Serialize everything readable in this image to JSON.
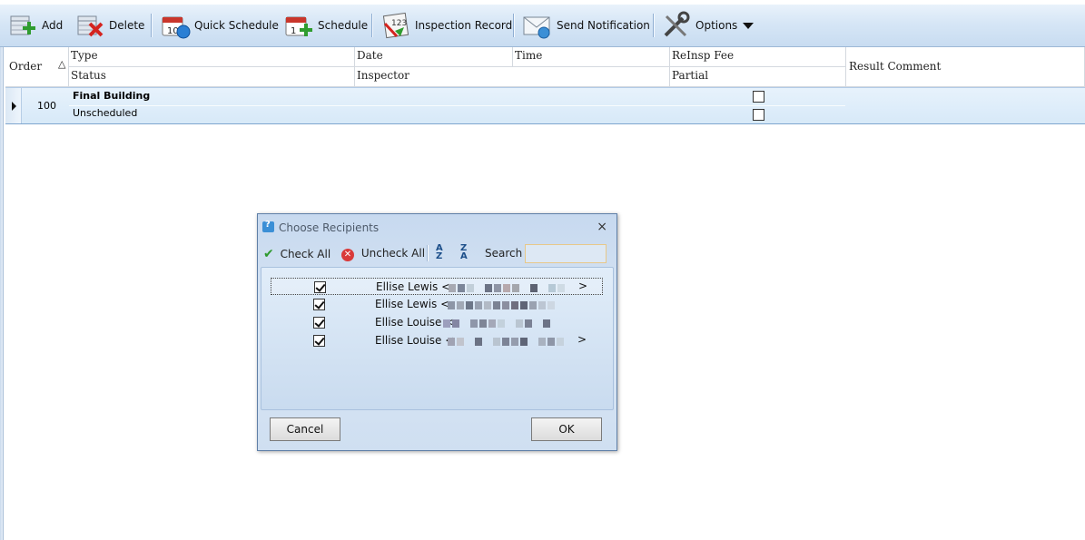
{
  "toolbar": {
    "add": "Add",
    "delete": "Delete",
    "quick_schedule": "Quick Schedule",
    "schedule": "Schedule",
    "inspection_record": "Inspection Record",
    "send_notification": "Send Notification",
    "options": "Options"
  },
  "grid": {
    "headers": {
      "order": "Order",
      "type": "Type",
      "status": "Status",
      "date": "Date",
      "inspector": "Inspector",
      "time": "Time",
      "reinsp_fee": "ReInsp Fee",
      "partial": "Partial",
      "result_comment": "Result Comment"
    },
    "row": {
      "order": "100",
      "type": "Final Building",
      "status": "Unscheduled",
      "reinsp_fee_checked": false,
      "partial_checked": false
    }
  },
  "dialog": {
    "title": "Choose Recipients",
    "check_all": "Check All",
    "uncheck_all": "Uncheck All",
    "search_label": "Search",
    "search_value": "",
    "recipients": [
      {
        "name": "Ellise Lewis <",
        "checked": true,
        "suffix": ">"
      },
      {
        "name": "Ellise Lewis <",
        "checked": true,
        "suffix": ""
      },
      {
        "name": "Ellise Louise <",
        "checked": true,
        "suffix": ""
      },
      {
        "name": "Ellise Louise <",
        "checked": true,
        "suffix": ">"
      }
    ],
    "cancel": "Cancel",
    "ok": "OK"
  },
  "colors": {
    "toolbar_bg": "#d6e6f6",
    "selected_row": "#dcebf8",
    "dialog_bg": "#d3e2f3"
  }
}
